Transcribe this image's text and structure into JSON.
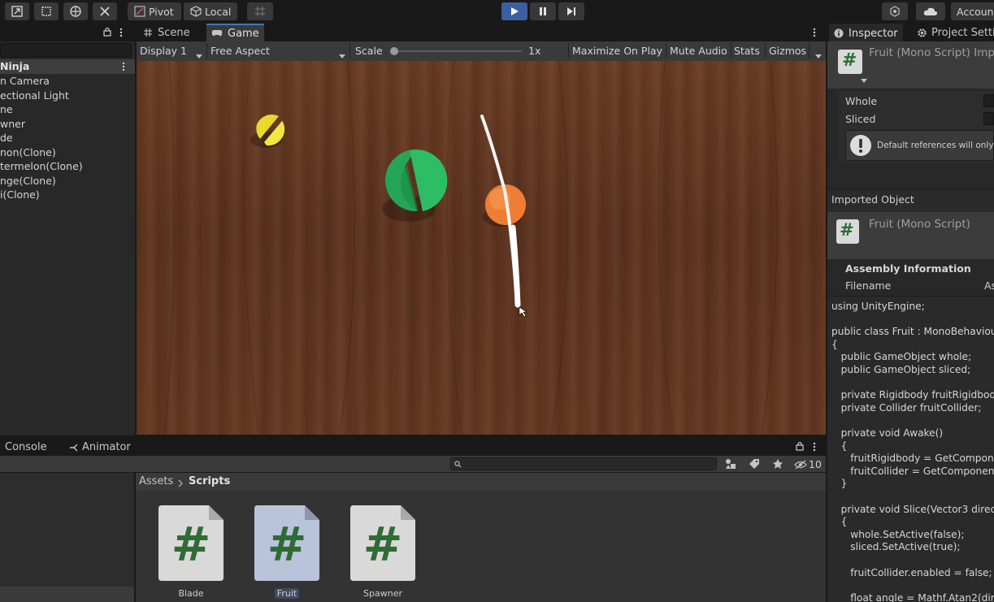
{
  "toolbar": {
    "pivot_label": "Pivot",
    "local_label": "Local",
    "account_label": "Accoun"
  },
  "hierarchy": {
    "scene_name": "Ninja",
    "items": [
      "n Camera",
      "ectional Light",
      "ne",
      "wner",
      "de",
      "non(Clone)",
      "termelon(Clone)",
      "nge(Clone)",
      "i(Clone)"
    ]
  },
  "game_view": {
    "tabs": [
      "Scene",
      "Game"
    ],
    "display": "Display 1",
    "aspect": "Free Aspect",
    "scale_label": "Scale",
    "scale_value": "1x",
    "scale_fraction": 0.0,
    "maximize": "Maximize On Play",
    "mute": "Mute Audio",
    "stats": "Stats",
    "gizmos": "Gizmos"
  },
  "bottom": {
    "tabs": [
      "Console",
      "Animator"
    ],
    "breadcrumb": [
      "Assets",
      "Scripts"
    ],
    "hidden_count": "10",
    "assets": [
      {
        "name": "Blade",
        "selected": false
      },
      {
        "name": "Fruit",
        "selected": true
      },
      {
        "name": "Spawner",
        "selected": false
      }
    ]
  },
  "inspector": {
    "tabs": [
      "Inspector",
      "Project Setti"
    ],
    "header_title": "Fruit (Mono Script) Imp",
    "fields": [
      "Whole",
      "Sliced"
    ],
    "help_text": "Default references will only",
    "imported_object_label": "Imported Object",
    "imported_title": "Fruit (Mono Script)",
    "assembly_info": "Assembly Information",
    "filename_label": "Filename",
    "filename_value": "As",
    "code": [
      "using UnityEngine;",
      "",
      "public class Fruit : MonoBehaviou",
      "{",
      "   public GameObject whole;",
      "   public GameObject sliced;",
      "",
      "   private Rigidbody fruitRigidbody",
      "   private Collider fruitCollider;",
      "",
      "   private void Awake()",
      "   {",
      "      fruitRigidbody = GetCompone",
      "      fruitCollider = GetComponent",
      "   }",
      "",
      "   private void Slice(Vector3 direc",
      "   {",
      "      whole.SetActive(false);",
      "      sliced.SetActive(true);",
      "",
      "      fruitCollider.enabled = false;",
      "",
      "      float angle = Mathf.Atan2(dire"
    ]
  },
  "colors": {
    "accent": "#3a79bb",
    "play_button": "#3c5fa0",
    "script_icon_green": "#2f6b34",
    "panel_bg": "#282828"
  }
}
